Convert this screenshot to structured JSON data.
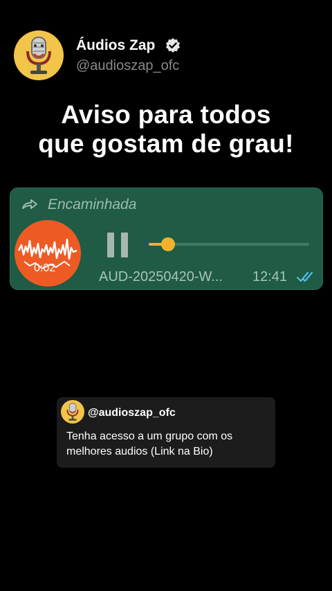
{
  "profile": {
    "name": "Áudios Zap",
    "handle": "@audioszap_ofc",
    "verified_icon": "verified-badge-icon"
  },
  "headline": {
    "line1": "Aviso para todos",
    "line2": "que gostam de grau!"
  },
  "audio_message": {
    "forwarded_label": "Encaminhada",
    "elapsed": "0:02",
    "progress_fraction": 0.12,
    "filename": "AUD-20250420-W...",
    "time": "12:41",
    "status_icon": "double-check-read-icon",
    "colors": {
      "bubble": "#1f5b45",
      "accent": "#f0b22c",
      "waveform_bg": "#ee5a24",
      "read_ticks": "#53bdeb"
    }
  },
  "caption_card": {
    "handle": "@audioszap_ofc",
    "text": "Tenha acesso a um grupo com os melhores audios (Link na Bio)"
  }
}
